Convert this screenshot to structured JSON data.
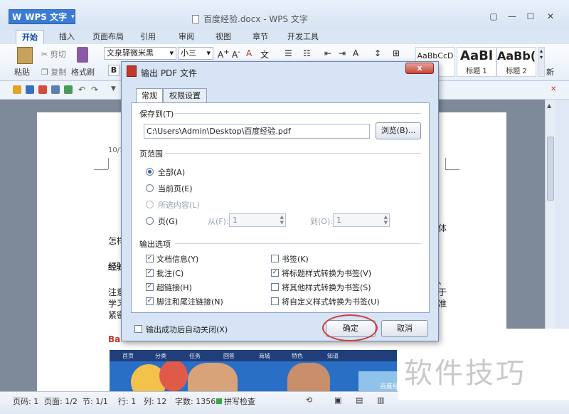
{
  "app": {
    "badge": "WPS 文字",
    "doc_title": "百度经验.docx - WPS 文字",
    "window_buttons": [
      "▢",
      "—",
      "☐",
      "✕"
    ]
  },
  "menu_tabs": [
    "开始",
    "插入",
    "页面布局",
    "引用",
    "审阅",
    "视图",
    "章节",
    "开发工具"
  ],
  "ribbon": {
    "paste": "粘贴",
    "cut": "剪切",
    "copy": "复制",
    "format_painter": "格式刷",
    "font_name": "文泉驿微米黑",
    "font_size": "小三",
    "bold": "B",
    "styles": [
      {
        "sample": "AaBbCcD",
        "name": ""
      },
      {
        "sample": "AaBl",
        "name": "标题 1"
      },
      {
        "sample": "AaBb(",
        "name": "标题 2"
      }
    ],
    "more_label": "新"
  },
  "document": {
    "header_date": "10/1",
    "lines": [
      "怎样",
      "经验",
      "注意",
      "学习",
      "紧密",
      "Ba"
    ],
    "right_chars": [
      "体",
      "、",
      "于",
      "准"
    ]
  },
  "banner": {
    "nav": [
      "首页",
      "分类",
      "任务",
      "回答",
      "商城",
      "特色",
      "知道"
    ],
    "caption": "百度经"
  },
  "status": {
    "page_num": "页码: 1",
    "pages": "页面: 1/2",
    "section": "节: 1/1",
    "row": "行: 1",
    "col": "列: 12",
    "words": "字数: 1356",
    "spell": "拼写检查"
  },
  "watermark": "软件技巧",
  "dialog": {
    "title": "输出 PDF 文件",
    "close": "x",
    "tabs": [
      "常规",
      "权限设置"
    ],
    "save_to_label": "保存到(T)",
    "path_value": "C:\\Users\\Admin\\Desktop\\百度经验.pdf",
    "browse": "浏览(B)...",
    "range_label": "页范围",
    "radios": [
      {
        "label": "全部(A)",
        "checked": true,
        "disabled": false
      },
      {
        "label": "当前页(E)",
        "checked": false,
        "disabled": false
      },
      {
        "label": "所选内容(L)",
        "checked": false,
        "disabled": true
      },
      {
        "label": "页(G)",
        "checked": false,
        "disabled": false
      }
    ],
    "from_label": "从(F):",
    "from_value": "1",
    "to_label": "到(O):",
    "to_value": "1",
    "options_label": "输出选项",
    "options_left": [
      {
        "label": "文档信息(Y)",
        "checked": true
      },
      {
        "label": "批注(C)",
        "checked": true
      },
      {
        "label": "超链接(H)",
        "checked": true
      },
      {
        "label": "脚注和尾注链接(N)",
        "checked": true
      }
    ],
    "options_right": [
      {
        "label": "书签(K)",
        "checked": false
      },
      {
        "label": "将标题样式转换为书签(V)",
        "checked": true
      },
      {
        "label": "将其他样式转换为书签(S)",
        "checked": false
      },
      {
        "label": "将自定义样式转换为书签(U)",
        "checked": false
      }
    ],
    "auto_close": {
      "label": "输出成功后自动关闭(X)",
      "checked": false
    },
    "ok": "确定",
    "cancel": "取消"
  }
}
